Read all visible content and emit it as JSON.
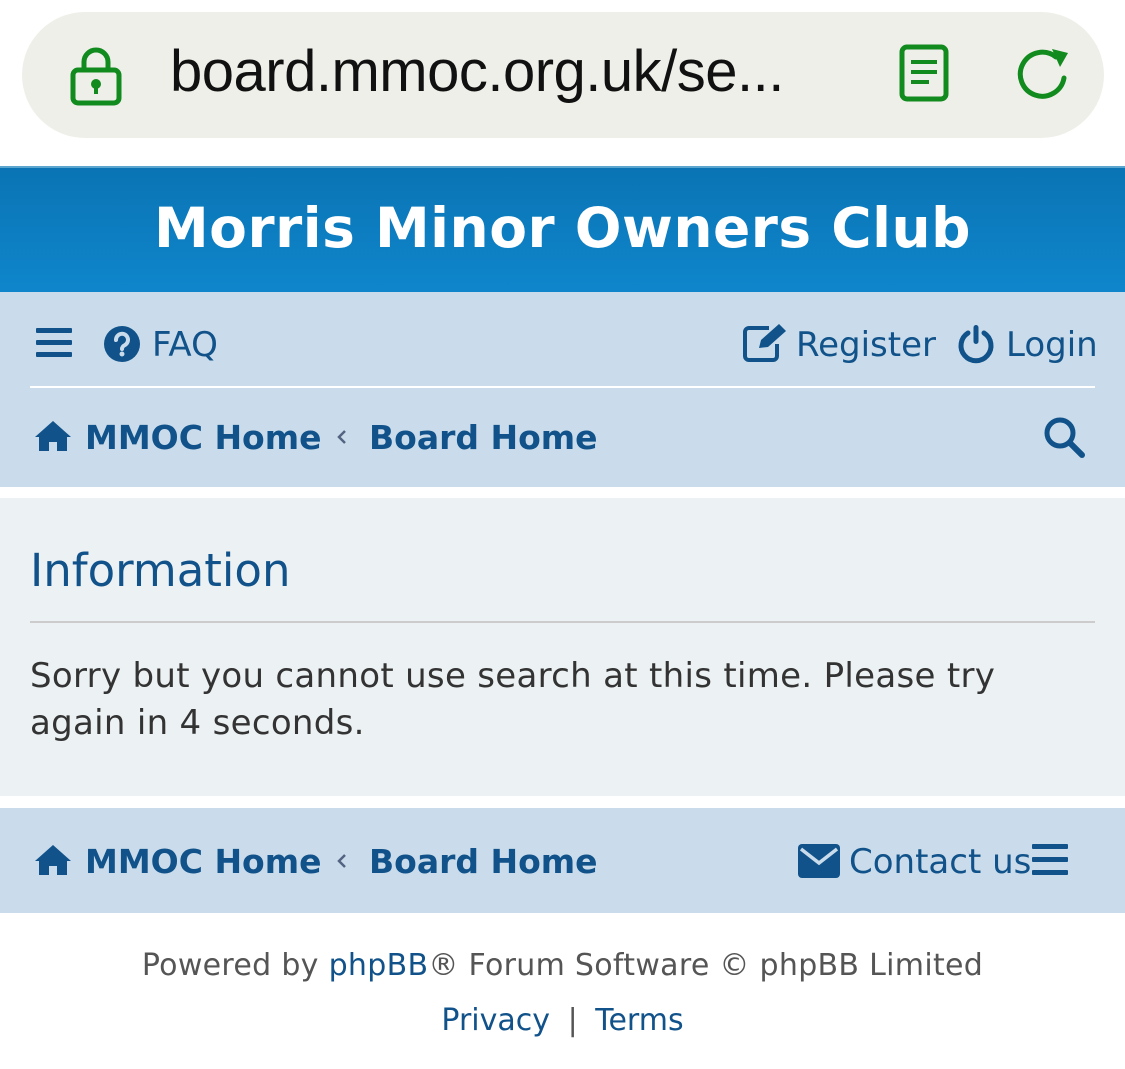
{
  "browser": {
    "url_display": "board.mmoc.org.uk/se...",
    "icons": {
      "lock": "lock-icon",
      "reader": "reader-mode-icon",
      "reload": "reload-icon"
    },
    "accent_color": "#118a1e"
  },
  "site": {
    "title": "Morris Minor Owners Club",
    "header_color": "#0b78bd"
  },
  "nav": {
    "faq_label": "FAQ",
    "register_label": "Register",
    "login_label": "Login",
    "breadcrumbs": [
      {
        "label": "MMOC Home"
      },
      {
        "label": "Board Home"
      }
    ]
  },
  "panel": {
    "title": "Information",
    "message": "Sorry but you cannot use search at this time. Please try again in 4 seconds."
  },
  "footer": {
    "breadcrumbs": [
      {
        "label": "MMOC Home"
      },
      {
        "label": "Board Home"
      }
    ],
    "contact_label": "Contact us",
    "powered_prefix": "Powered by ",
    "powered_link": "phpBB",
    "powered_suffix": "® Forum Software © phpBB Limited",
    "privacy_label": "Privacy",
    "separator": "|",
    "terms_label": "Terms"
  },
  "colors": {
    "link": "#105289",
    "nav_bg": "#cadceb",
    "panel_bg": "#ecf1f3"
  }
}
